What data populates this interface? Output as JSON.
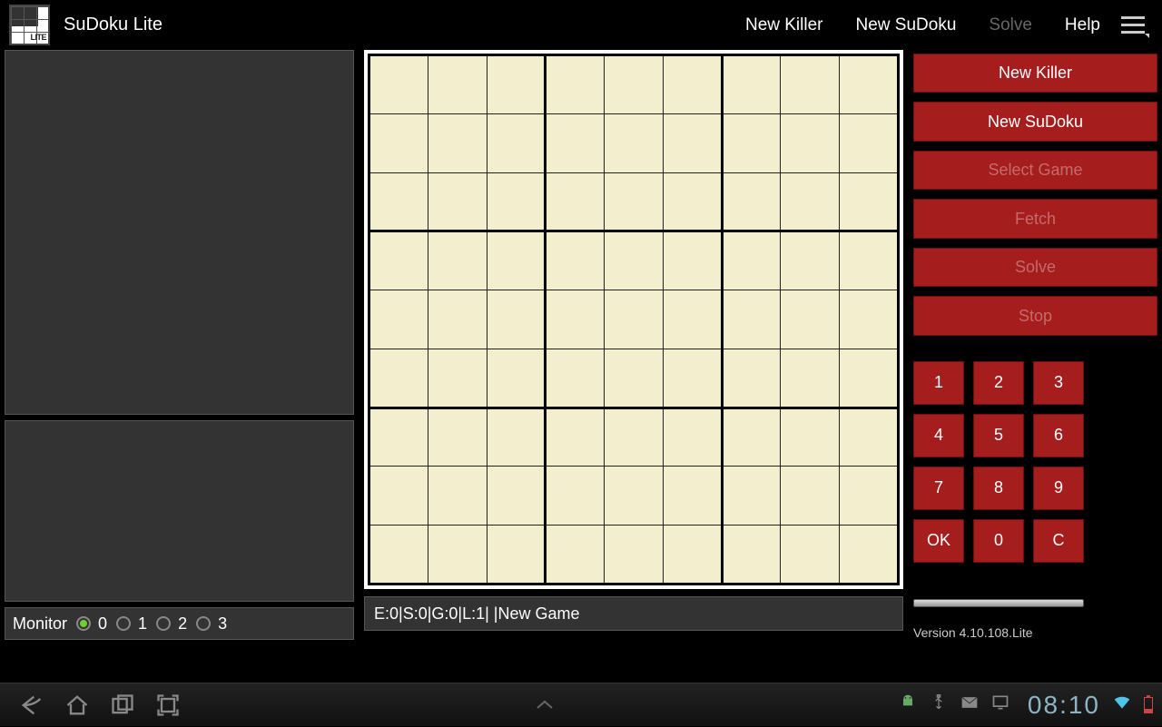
{
  "app": {
    "title": "SuDoku Lite"
  },
  "topbar": {
    "new_killer": "New Killer",
    "new_sudoku": "New SuDoku",
    "solve": "Solve",
    "help": "Help"
  },
  "monitor": {
    "label": "Monitor",
    "options": [
      "0",
      "1",
      "2",
      "3"
    ],
    "selected": 0
  },
  "status": {
    "text": "E:0|S:0|G:0|L:1|  |New Game"
  },
  "buttons": {
    "new_killer": "New Killer",
    "new_sudoku": "New SuDoku",
    "select_game": "Select Game",
    "fetch": "Fetch",
    "solve": "Solve",
    "stop": "Stop"
  },
  "keypad": [
    "1",
    "2",
    "3",
    "4",
    "5",
    "6",
    "7",
    "8",
    "9",
    "OK",
    "0",
    "C"
  ],
  "version": "Version 4.10.108.Lite",
  "clock": "08:10"
}
